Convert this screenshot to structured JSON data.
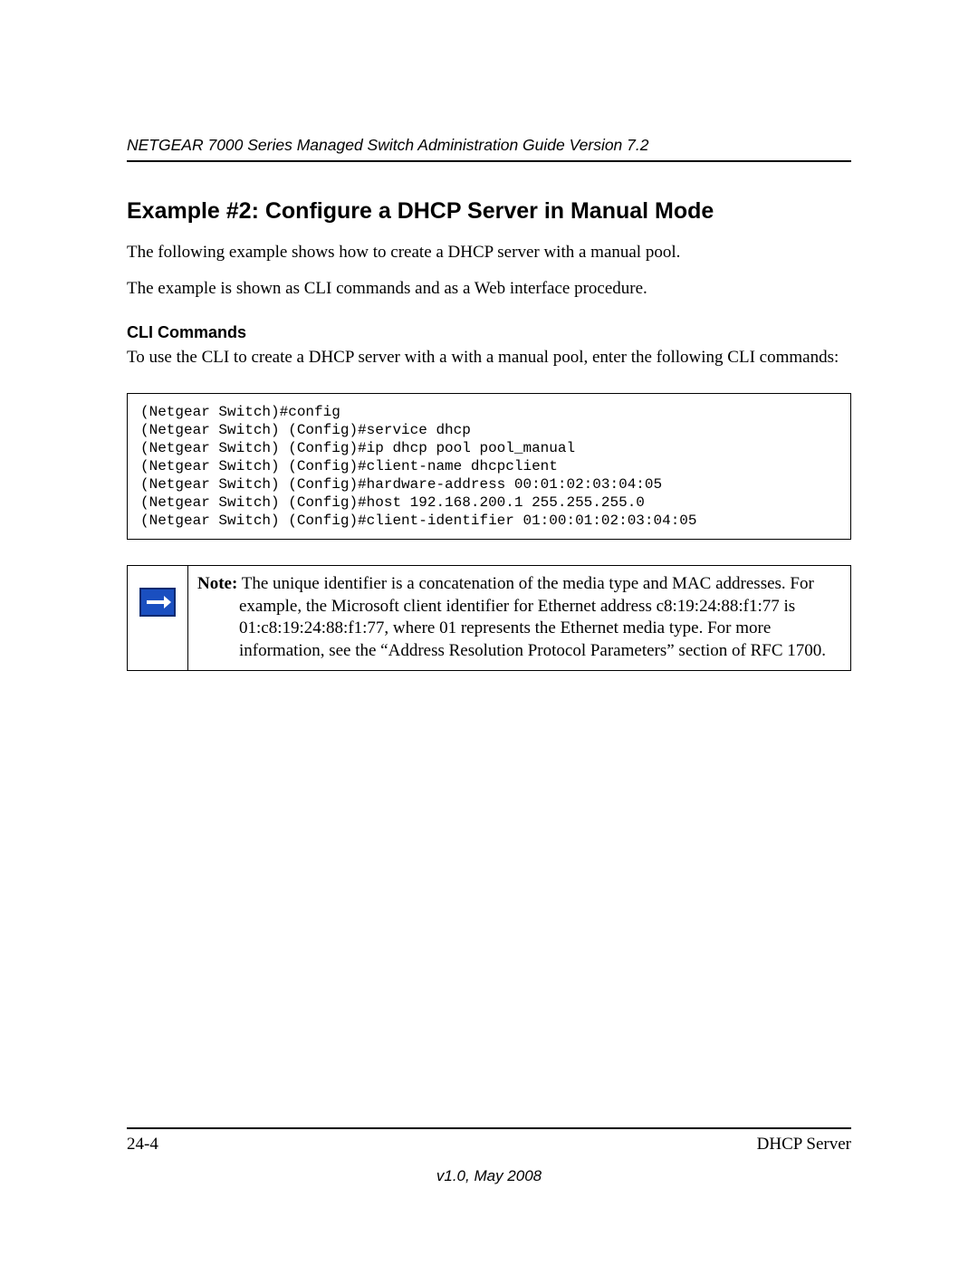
{
  "header": {
    "title": "NETGEAR 7000 Series Managed Switch Administration Guide Version 7.2"
  },
  "section": {
    "title": "Example #2: Configure a DHCP Server in Manual Mode",
    "para1": "The following example shows how to create a DHCP server with a manual pool.",
    "para2": "The example is shown as CLI commands and as a Web interface procedure."
  },
  "cli": {
    "heading": "CLI Commands",
    "intro": "To use the CLI to create a DHCP server with a with a manual pool, enter the following CLI commands:",
    "code": "(Netgear Switch)#config\n(Netgear Switch) (Config)#service dhcp\n(Netgear Switch) (Config)#ip dhcp pool pool_manual\n(Netgear Switch) (Config)#client-name dhcpclient\n(Netgear Switch) (Config)#hardware-address 00:01:02:03:04:05\n(Netgear Switch) (Config)#host 192.168.200.1 255.255.255.0\n(Netgear Switch) (Config)#client-identifier 01:00:01:02:03:04:05"
  },
  "note": {
    "label": "Note:",
    "firstline": " The unique identifier is a concatenation of the media type and MAC addresses. For",
    "rest": "example, the Microsoft client identifier for Ethernet address c8:19:24:88:f1:77 is 01:c8:19:24:88:f1:77, where 01 represents the Ethernet media type. For more information, see the “Address Resolution Protocol Parameters” section of RFC 1700."
  },
  "footer": {
    "page": "24-4",
    "topic": "DHCP Server",
    "version": "v1.0, May 2008"
  }
}
